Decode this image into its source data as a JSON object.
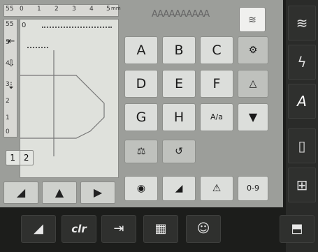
{
  "ruler": {
    "top_label": "55",
    "top_numbers": [
      "0",
      "1",
      "2",
      "3",
      "4",
      "5"
    ],
    "top_unit": "mm",
    "left_label": "55",
    "left_numbers": [
      "5",
      "4",
      "3",
      "2",
      "1",
      "0"
    ]
  },
  "preview": {
    "ref_label": "0"
  },
  "side_icons": [
    "stitch-width-icon",
    "stitch-length-icon",
    "needle-position-icon"
  ],
  "alpha_header": "AAAAAAAAAA",
  "keys": {
    "row1": [
      "A",
      "B",
      "C"
    ],
    "row2": [
      "D",
      "E",
      "F"
    ],
    "row3": [
      "G",
      "H",
      "A/a"
    ],
    "digits": "0-9",
    "backspace_label": "⌫"
  },
  "page_toggle": [
    "1",
    "2"
  ],
  "bottom_left": [
    "triangle-left",
    "triangle-mirror",
    "triangle-right"
  ],
  "bottom_row2": [
    "eye-icon",
    "triangle-combo",
    "warn-triangle"
  ],
  "right_col": [
    "zigzag-icon",
    "lightning-icon",
    "alphabet-A",
    "rect-icon",
    "grid-icon"
  ],
  "bottom_bar": {
    "clr": "clr"
  },
  "colors": {
    "bg": "#1c1d1b",
    "panel": "#9c9e9a",
    "key": "#dcdedb"
  }
}
